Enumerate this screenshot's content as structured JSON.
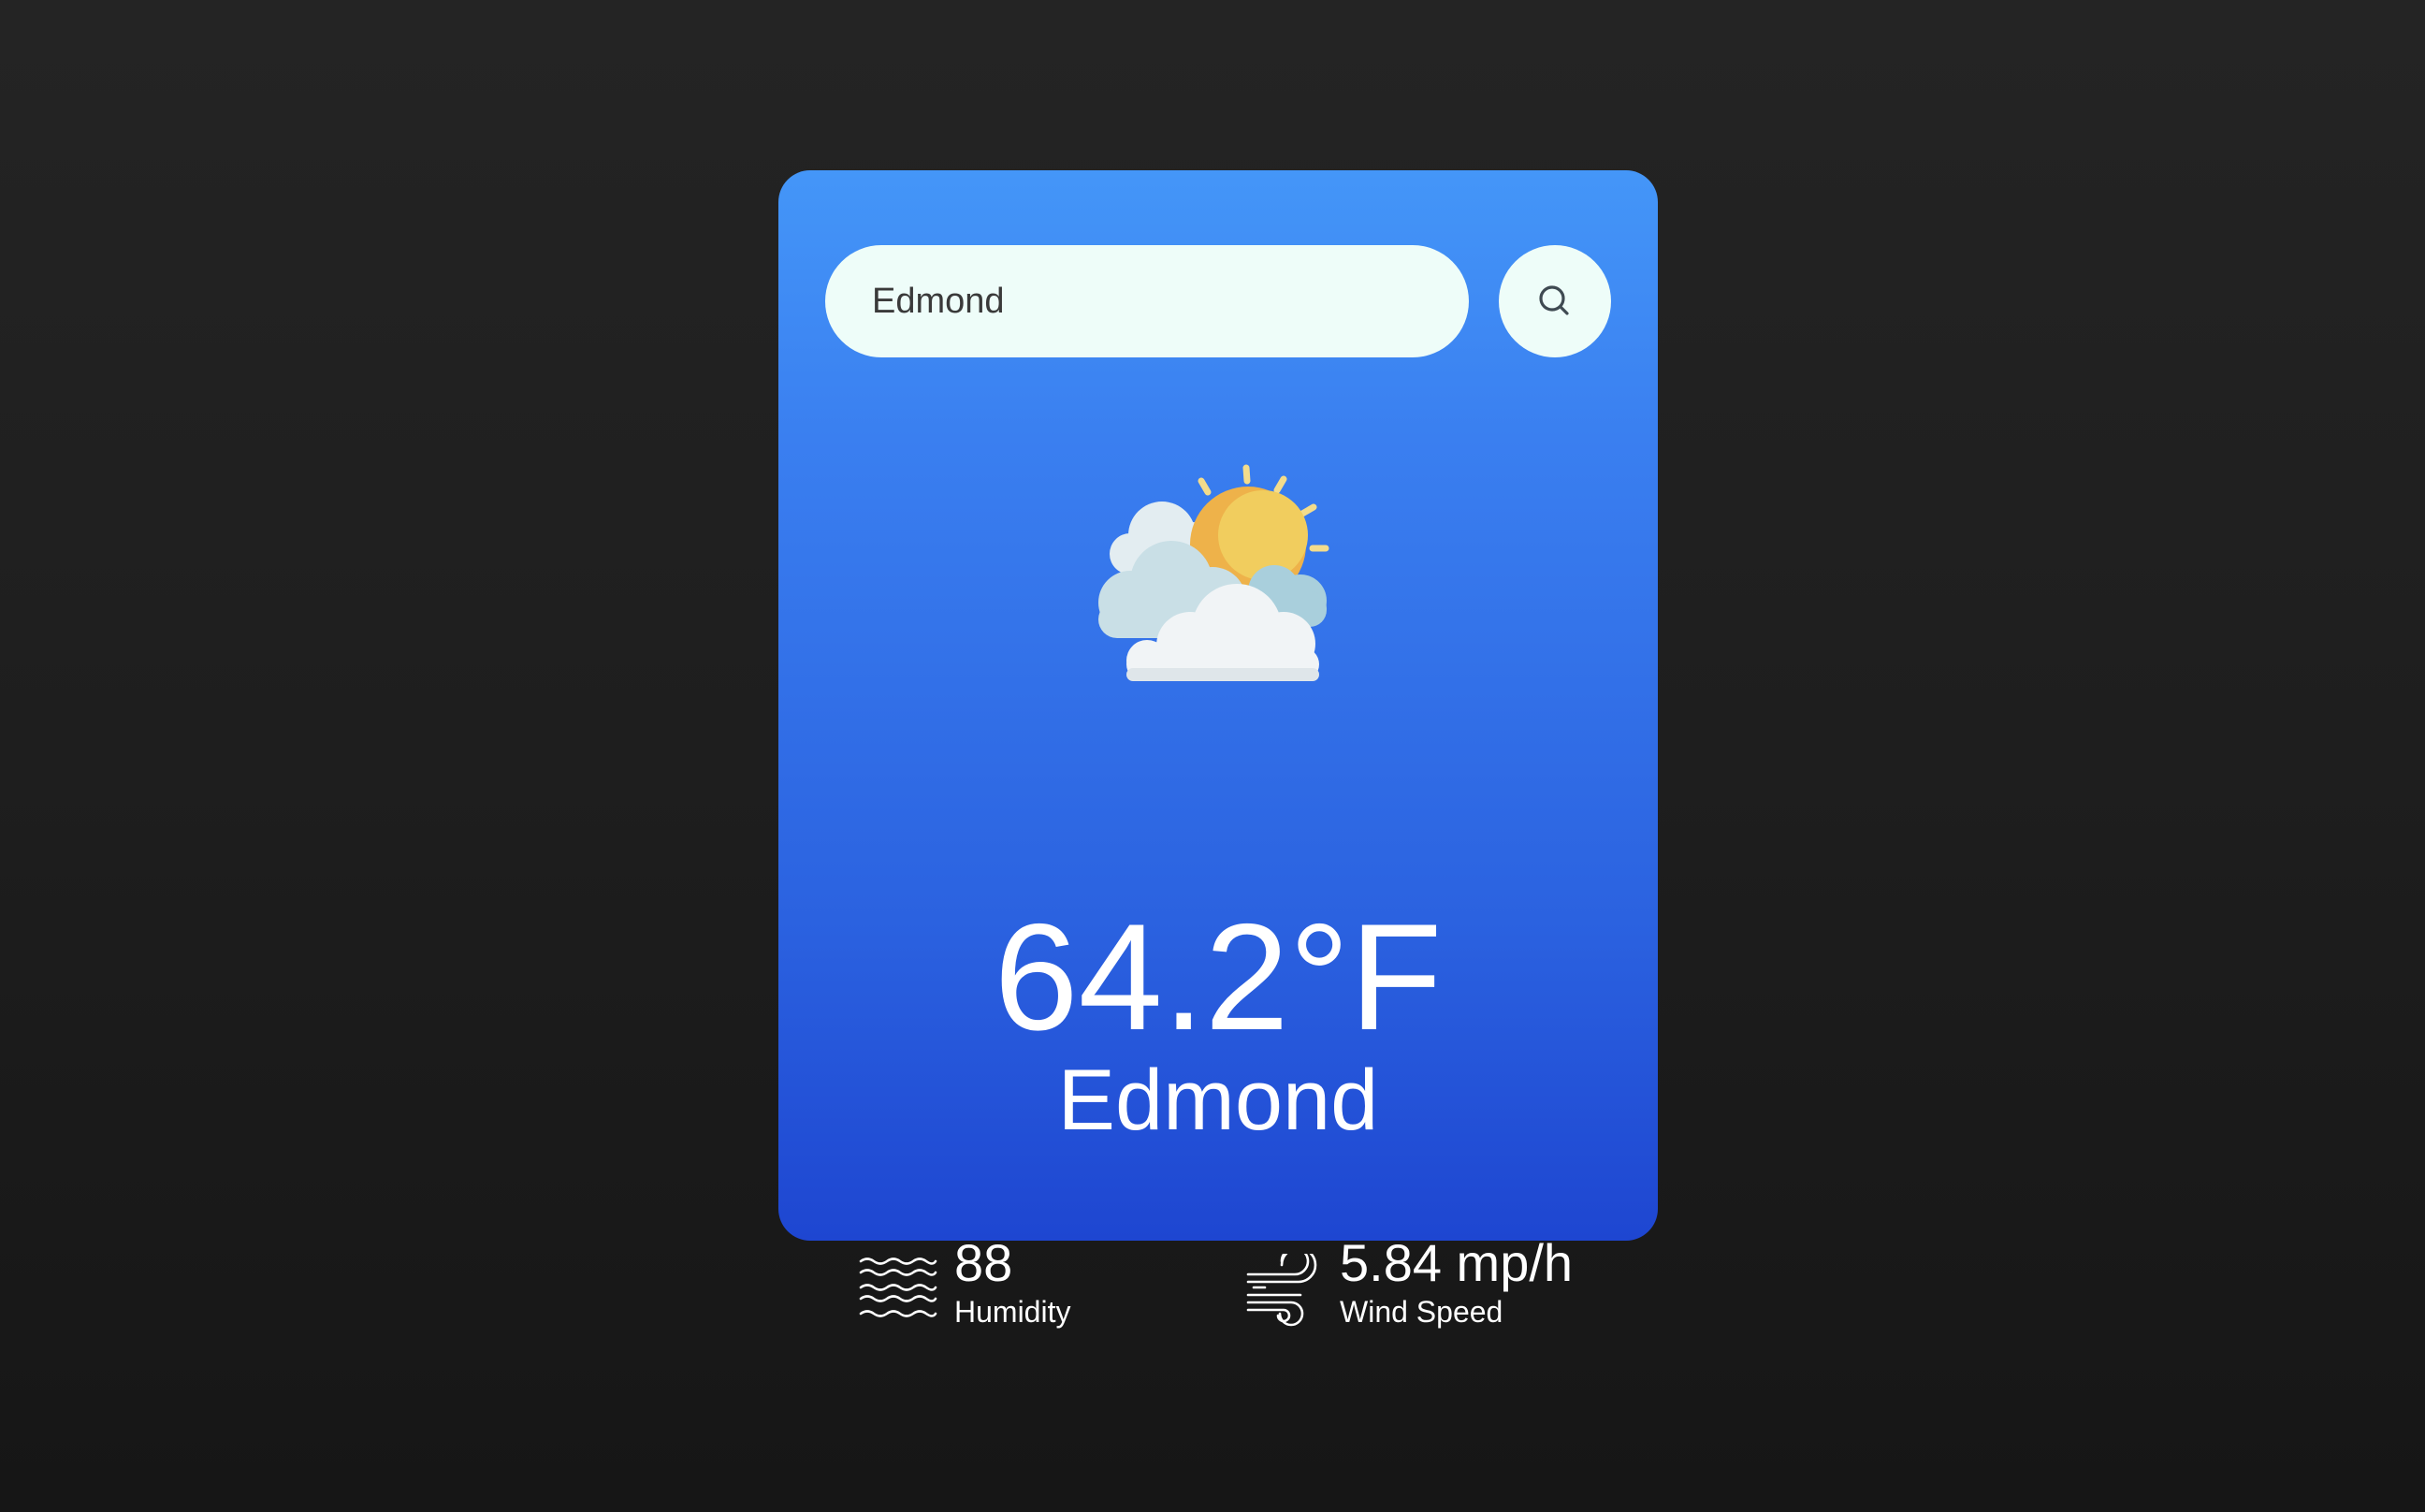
{
  "search": {
    "value": "Edmond",
    "button_icon": "search-icon"
  },
  "weather": {
    "icon": "partly-cloudy-sun-icon",
    "temperature": "64.2°F",
    "city": "Edmond"
  },
  "details": {
    "humidity": {
      "icon": "humidity-waves-icon",
      "value": "88",
      "label": "Humidity"
    },
    "wind": {
      "icon": "wind-icon",
      "value": "5.84 mp/h",
      "label": "Wind Speed"
    }
  },
  "colors": {
    "background": "#1e1e1e",
    "card_top": "#4496f8",
    "card_bottom": "#1e46d1",
    "input_bg": "#eefdf9",
    "text": "#ffffff"
  }
}
